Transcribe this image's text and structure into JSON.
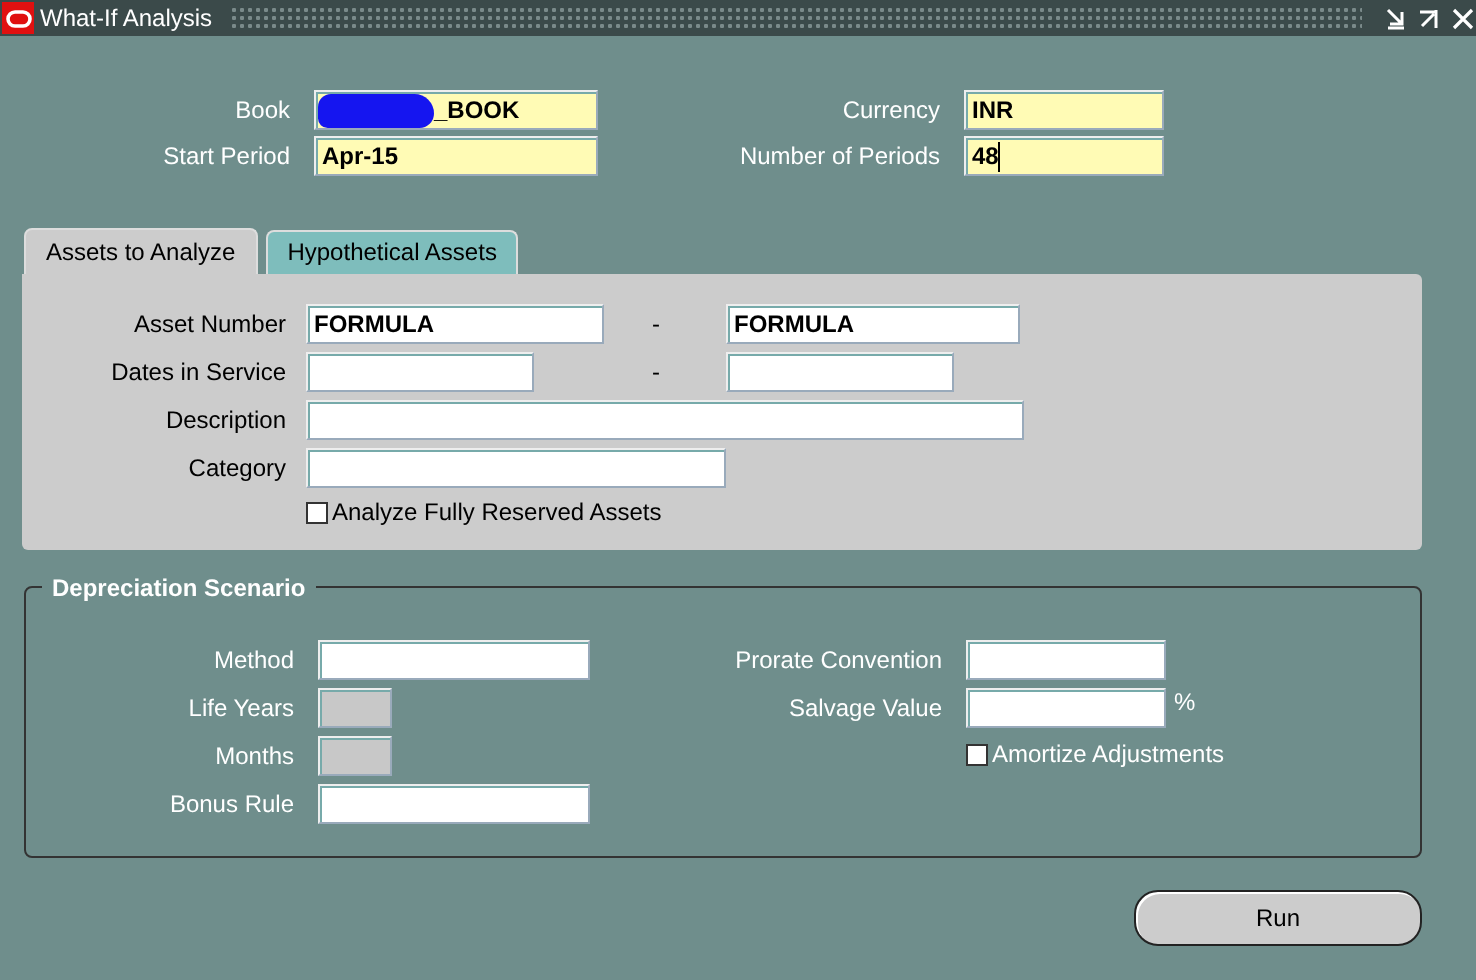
{
  "window": {
    "title": "What-If Analysis"
  },
  "header_fields": [
    {
      "label": "Book",
      "value": "_BOOK",
      "kind": "required",
      "redacted": true,
      "focused": false
    },
    {
      "label": "Currency",
      "value": "INR",
      "kind": "required",
      "redacted": false,
      "focused": false
    },
    {
      "label": "Start Period",
      "value": "Apr-15",
      "kind": "required",
      "redacted": false,
      "focused": false
    },
    {
      "label": "Number of Periods",
      "value": "48",
      "kind": "required",
      "redacted": false,
      "focused": true
    }
  ],
  "tabs": [
    {
      "label": "Assets to Analyze",
      "selected": true
    },
    {
      "label": "Hypothetical Assets",
      "selected": false
    }
  ],
  "asset_fields": [
    {
      "label": "Asset Number",
      "kind": "range",
      "values": [
        "FORMULA",
        "FORMULA"
      ],
      "separator": "-"
    },
    {
      "label": "Dates in Service",
      "kind": "range",
      "separator": "-"
    },
    {
      "label": "Description",
      "kind": "wide"
    },
    {
      "label": "Category",
      "kind": "medium"
    }
  ],
  "asset_checkbox": {
    "label": "Analyze Fully Reserved Assets",
    "checked": false
  },
  "depreciation": {
    "title": "Depreciation Scenario",
    "left_fields": [
      {
        "label": "Method",
        "kind": "normal"
      },
      {
        "label": "Life Years",
        "kind": "disabled"
      },
      {
        "label": "Months",
        "kind": "disabled"
      },
      {
        "label": "Bonus Rule",
        "kind": "normal"
      }
    ],
    "right_fields": [
      {
        "label": "Prorate Convention",
        "kind": "normal"
      },
      {
        "label": "Salvage Value",
        "kind": "normal",
        "suffix": "%"
      }
    ],
    "checkbox": {
      "label": "Amortize Adjustments",
      "checked": false
    }
  },
  "buttons": [
    "Run"
  ]
}
